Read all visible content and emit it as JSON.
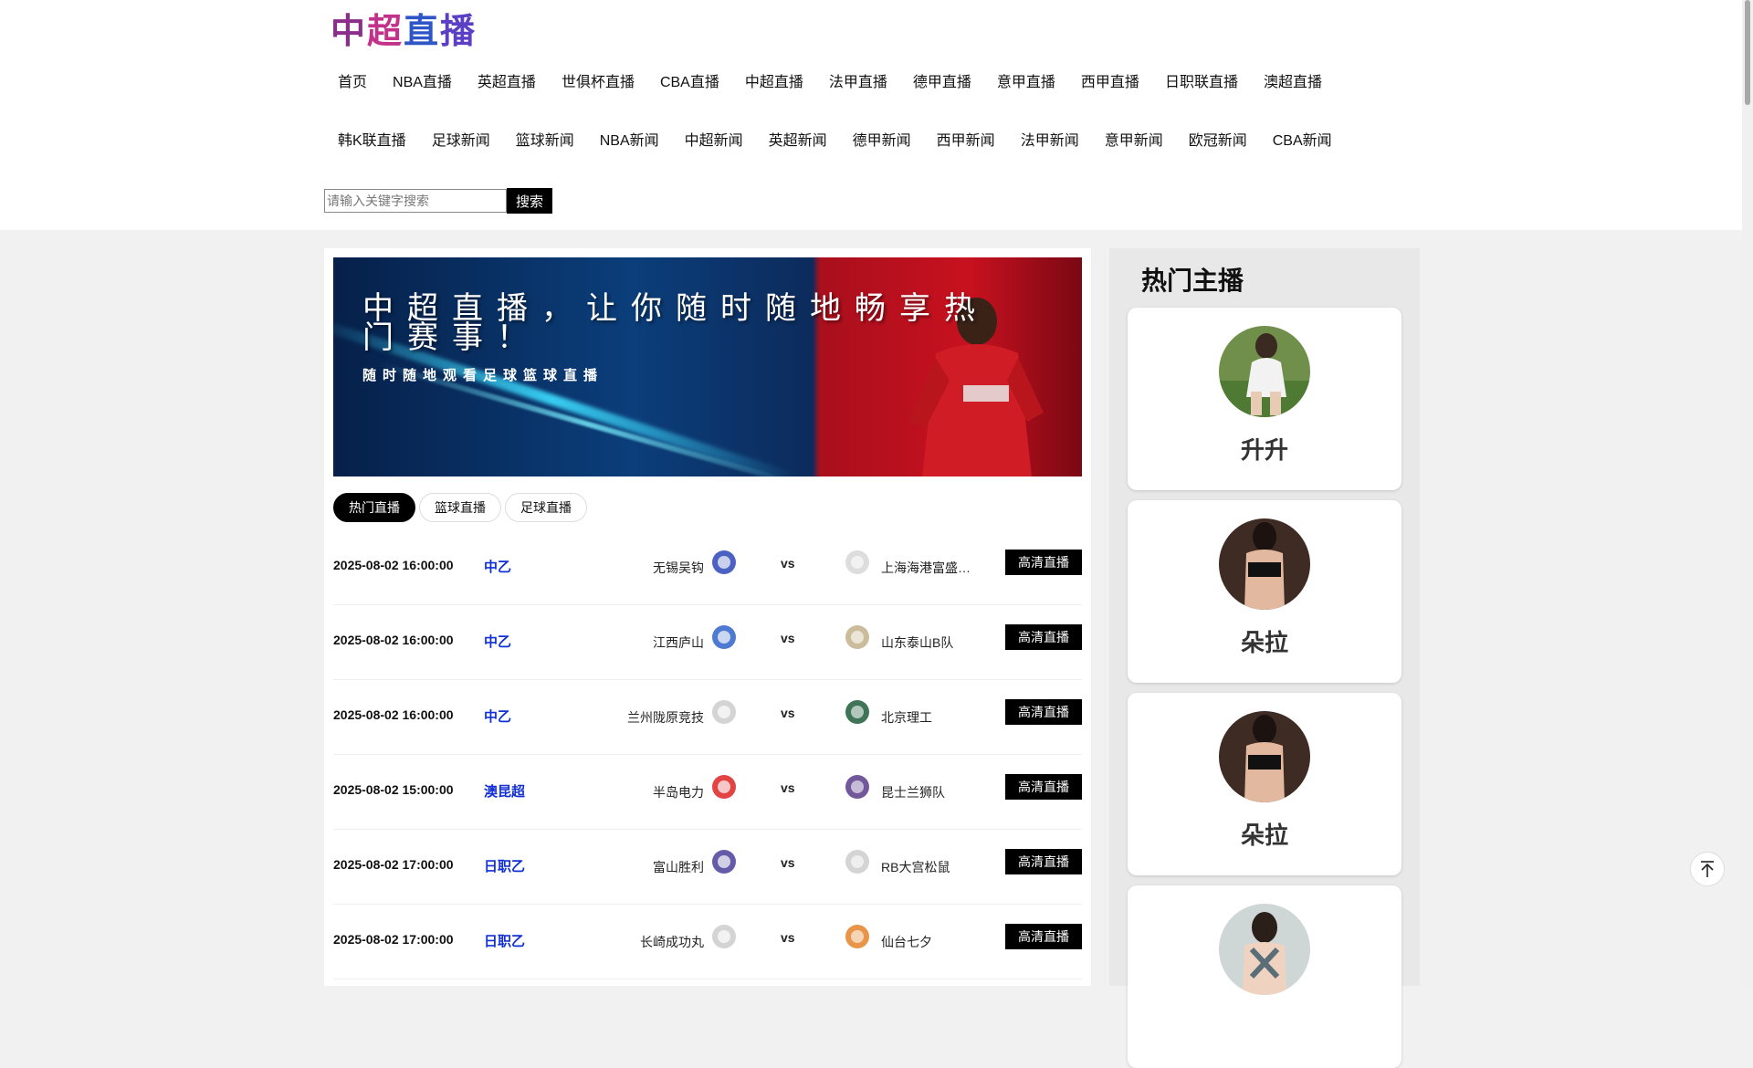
{
  "site": {
    "logo_text": [
      "中",
      "超",
      "直",
      "播"
    ]
  },
  "nav": {
    "row1": [
      "首页",
      "NBA直播",
      "英超直播",
      "世俱杯直播",
      "CBA直播",
      "中超直播",
      "法甲直播",
      "德甲直播",
      "意甲直播",
      "西甲直播",
      "日职联直播",
      "澳超直播"
    ],
    "row2": [
      "韩K联直播",
      "足球新闻",
      "篮球新闻",
      "NBA新闻",
      "中超新闻",
      "英超新闻",
      "德甲新闻",
      "西甲新闻",
      "法甲新闻",
      "意甲新闻",
      "欧冠新闻",
      "CBA新闻"
    ]
  },
  "search": {
    "placeholder": "请输入关键字搜索",
    "button": "搜索"
  },
  "banner": {
    "title": "中超直播，让你随时随地畅享热门赛事！",
    "subtitle": "随时随地观看足球篮球直播"
  },
  "tabs": [
    "热门直播",
    "篮球直播",
    "足球直播"
  ],
  "matches": [
    {
      "time": "2025-08-02 16:00:00",
      "league": "中乙",
      "home": "无锡吴钩",
      "vs": "vs",
      "away": "上海海港富盛…",
      "button": "高清直播"
    },
    {
      "time": "2025-08-02 16:00:00",
      "league": "中乙",
      "home": "江西庐山",
      "vs": "vs",
      "away": "山东泰山B队",
      "button": "高清直播"
    },
    {
      "time": "2025-08-02 16:00:00",
      "league": "中乙",
      "home": "兰州陇原竞技",
      "vs": "vs",
      "away": "北京理工",
      "button": "高清直播"
    },
    {
      "time": "2025-08-02 15:00:00",
      "league": "澳昆超",
      "home": "半岛电力",
      "vs": "vs",
      "away": "昆士兰狮队",
      "button": "高清直播"
    },
    {
      "time": "2025-08-02 17:00:00",
      "league": "日职乙",
      "home": "富山胜利",
      "vs": "vs",
      "away": "RB大宫松鼠",
      "button": "高清直播"
    },
    {
      "time": "2025-08-02 17:00:00",
      "league": "日职乙",
      "home": "长崎成功丸",
      "vs": "vs",
      "away": "仙台七夕",
      "button": "高清直播"
    }
  ],
  "sidebar": {
    "title": "热门主播",
    "anchors": [
      {
        "name": "升升"
      },
      {
        "name": "朵拉"
      },
      {
        "name": "朵拉"
      },
      {
        "name": ""
      }
    ]
  },
  "colors": {
    "league_link": "#1230d6",
    "button_bg": "#000000",
    "page_bg": "#f1f1f1"
  }
}
